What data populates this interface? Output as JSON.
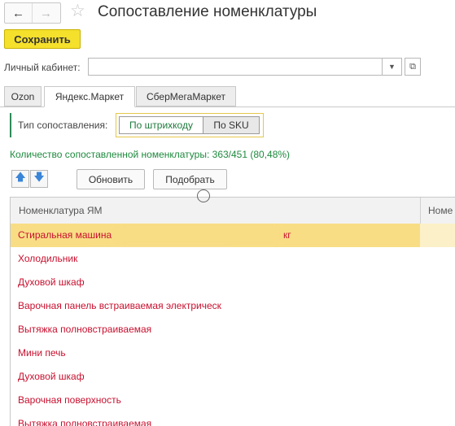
{
  "window": {
    "title": "Сопоставление номенклатуры",
    "back_icon": "arrow-left-icon",
    "forward_icon": "arrow-right-icon",
    "favorite_icon": "star-icon"
  },
  "toolbar": {
    "save_label": "Сохранить",
    "save_color": "#f5e02c"
  },
  "account": {
    "label": "Личный кабинет:",
    "value": "",
    "dropdown_icon": "dropdown-arrow-icon",
    "open_icon": "open-link-icon"
  },
  "tabs": [
    {
      "label": "Ozon",
      "active": false
    },
    {
      "label": "Яндекс.Маркет",
      "active": true
    },
    {
      "label": "СберМегаМаркет",
      "active": false
    }
  ],
  "match_type": {
    "label": "Тип сопоставления:",
    "options": [
      "По штрихкоду",
      "По SKU"
    ],
    "selected": "По штрихкоду"
  },
  "count_text": "Количество сопоставленной номенклатуры: 363/451 (80,48%)",
  "actions": {
    "up_icon": "arrow-up-icon",
    "down_icon": "arrow-down-icon",
    "refresh_label": "Обновить",
    "select_label": "Подобрать"
  },
  "table": {
    "columns": [
      "Номенклатура ЯМ",
      "Номе"
    ],
    "rows": [
      {
        "text": "Стиральная машина",
        "tail": "кг",
        "selected": true
      },
      {
        "text": "Холодильник",
        "tail": "",
        "selected": false
      },
      {
        "text": "Духовой шкаф",
        "tail": "",
        "selected": false
      },
      {
        "text": "Варочная панель встраиваемая электрическ",
        "tail": "",
        "selected": false
      },
      {
        "text": "Вытяжка полновстраиваемая",
        "tail": "",
        "selected": false
      },
      {
        "text": "Мини печь",
        "tail": "",
        "selected": false
      },
      {
        "text": "Духовой шкаф",
        "tail": "",
        "selected": false
      },
      {
        "text": "Варочная поверхность",
        "tail": "",
        "selected": false
      },
      {
        "text": "Вытяжка полновстраиваемая",
        "tail": "",
        "selected": false
      }
    ],
    "text_color": "#c8102e",
    "selected_color": "#f8dd85"
  }
}
